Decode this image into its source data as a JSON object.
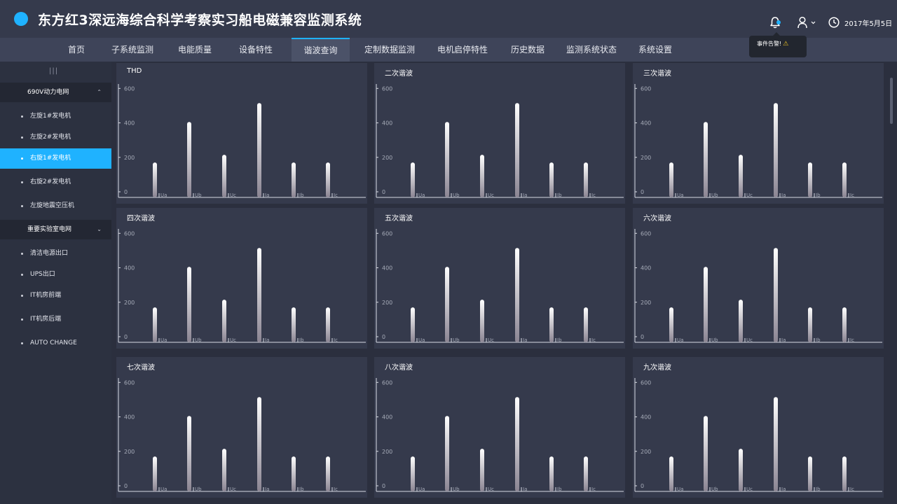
{
  "header": {
    "title": "东方红3深远海综合科学考察实习船电磁兼容监测系统",
    "date": "2017年5月5日",
    "icons": [
      "logo-dot",
      "bell-icon",
      "user-icon",
      "clock-icon"
    ]
  },
  "tooltip": {
    "text": "事件告警!",
    "icon": "warning-icon"
  },
  "nav": {
    "items": [
      {
        "label": "首页"
      },
      {
        "label": "子系统监测"
      },
      {
        "label": "电能质量"
      },
      {
        "label": "设备特性"
      },
      {
        "label": "谐波查询",
        "active": true
      },
      {
        "label": "定制数据监测"
      },
      {
        "label": "电机启停特性"
      },
      {
        "label": "历史数据"
      },
      {
        "label": "监测系统状态"
      },
      {
        "label": "系统设置"
      }
    ]
  },
  "sidebar": {
    "group1": {
      "label": "690V动力电网"
    },
    "group1_items": [
      {
        "label": "左旋1#发电机"
      },
      {
        "label": "左旋2#发电机"
      },
      {
        "label": "右旋1#发电机",
        "active": true
      },
      {
        "label": "右旋2#发电机"
      },
      {
        "label": "左旋地震空压机"
      }
    ],
    "group2": {
      "label": "重要实验室电网"
    },
    "group2_items": [
      {
        "label": "清洁电源出口"
      },
      {
        "label": "UPS出口"
      },
      {
        "label": "IT机房前端"
      },
      {
        "label": "IT机房后端"
      },
      {
        "label": "AUTO CHANGE"
      }
    ]
  },
  "panels": [
    {
      "title": "THD"
    },
    {
      "title": "二次谐波"
    },
    {
      "title": "三次谐波"
    },
    {
      "title": "四次谐波"
    },
    {
      "title": "五次谐波"
    },
    {
      "title": "六次谐波"
    },
    {
      "title": "七次谐波"
    },
    {
      "title": "八次谐波"
    },
    {
      "title": "九次谐波"
    }
  ],
  "chart_data": {
    "type": "bar",
    "categories": [
      "Ua",
      "Ub",
      "Uc",
      "Ia",
      "Ib",
      "Ic"
    ],
    "values": [
      170,
      405,
      215,
      515,
      170,
      170
    ],
    "yticks": [
      0,
      200,
      400,
      600
    ],
    "ylim": [
      0,
      650
    ],
    "bar_colors": [
      "#ffffff",
      "#8a8492"
    ]
  }
}
